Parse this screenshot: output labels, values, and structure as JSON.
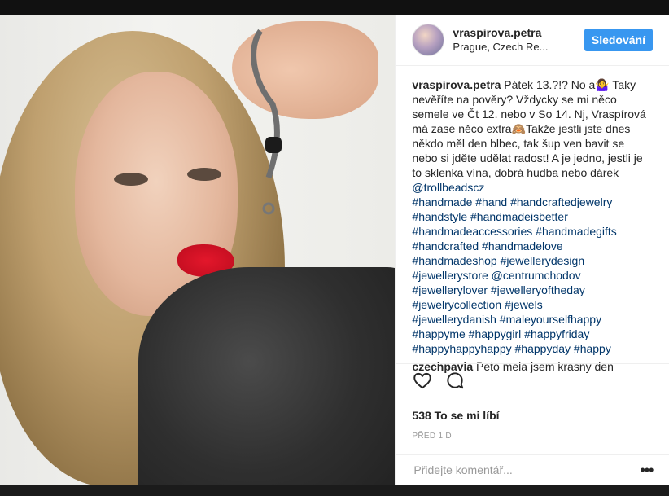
{
  "post": {
    "username": "vraspirova.petra",
    "location": "Prague, Czech Re...",
    "follow_label": "Sledování",
    "caption_text": "Pátek 13.?!? No a🤷‍♀️ Taky nevěříte na pověry? Vždycky se mi něco semele ve Čt 12. nebo v So 14. Nj, Vraspírová má zase něco extra🙈Takže jestli jste dnes někdo měl den blbec, tak šup ven bavit se nebo si jděte udělat radost! A je jedno, jestli je to sklenka vína, dobrá hudba nebo dárek",
    "mention": "@trollbeadscz",
    "hashtags_lines": [
      "#handmade #hand #handcraftedjewelry",
      "#handstyle #handmadeisbetter",
      "#handmadeaccessories #handmadegifts",
      "#handcrafted #handmadelove",
      "#handmadeshop #jewellerydesign",
      "#jewellerystore @centrumchodov",
      "#jewellerylover #jewelleryoftheday",
      "#jewelrycollection #jewels",
      "#jewellerydanish #maleyourselfhappy",
      "#happyme #happygirl #happyfriday",
      "#happyhappyhappy #happyday #happy"
    ],
    "comment": {
      "username": "czechpavla",
      "text": "Peto mela jsem krasny den"
    },
    "likes": "538 To se mi líbí",
    "time": "PŘED 1 D",
    "comment_placeholder": "Přidejte komentář...",
    "more_label": "•••"
  },
  "icons": {
    "like": "heart-icon",
    "comment": "comment-icon"
  },
  "colors": {
    "accent": "#3897f0",
    "link": "#003569",
    "text": "#262626",
    "muted": "#999999"
  }
}
